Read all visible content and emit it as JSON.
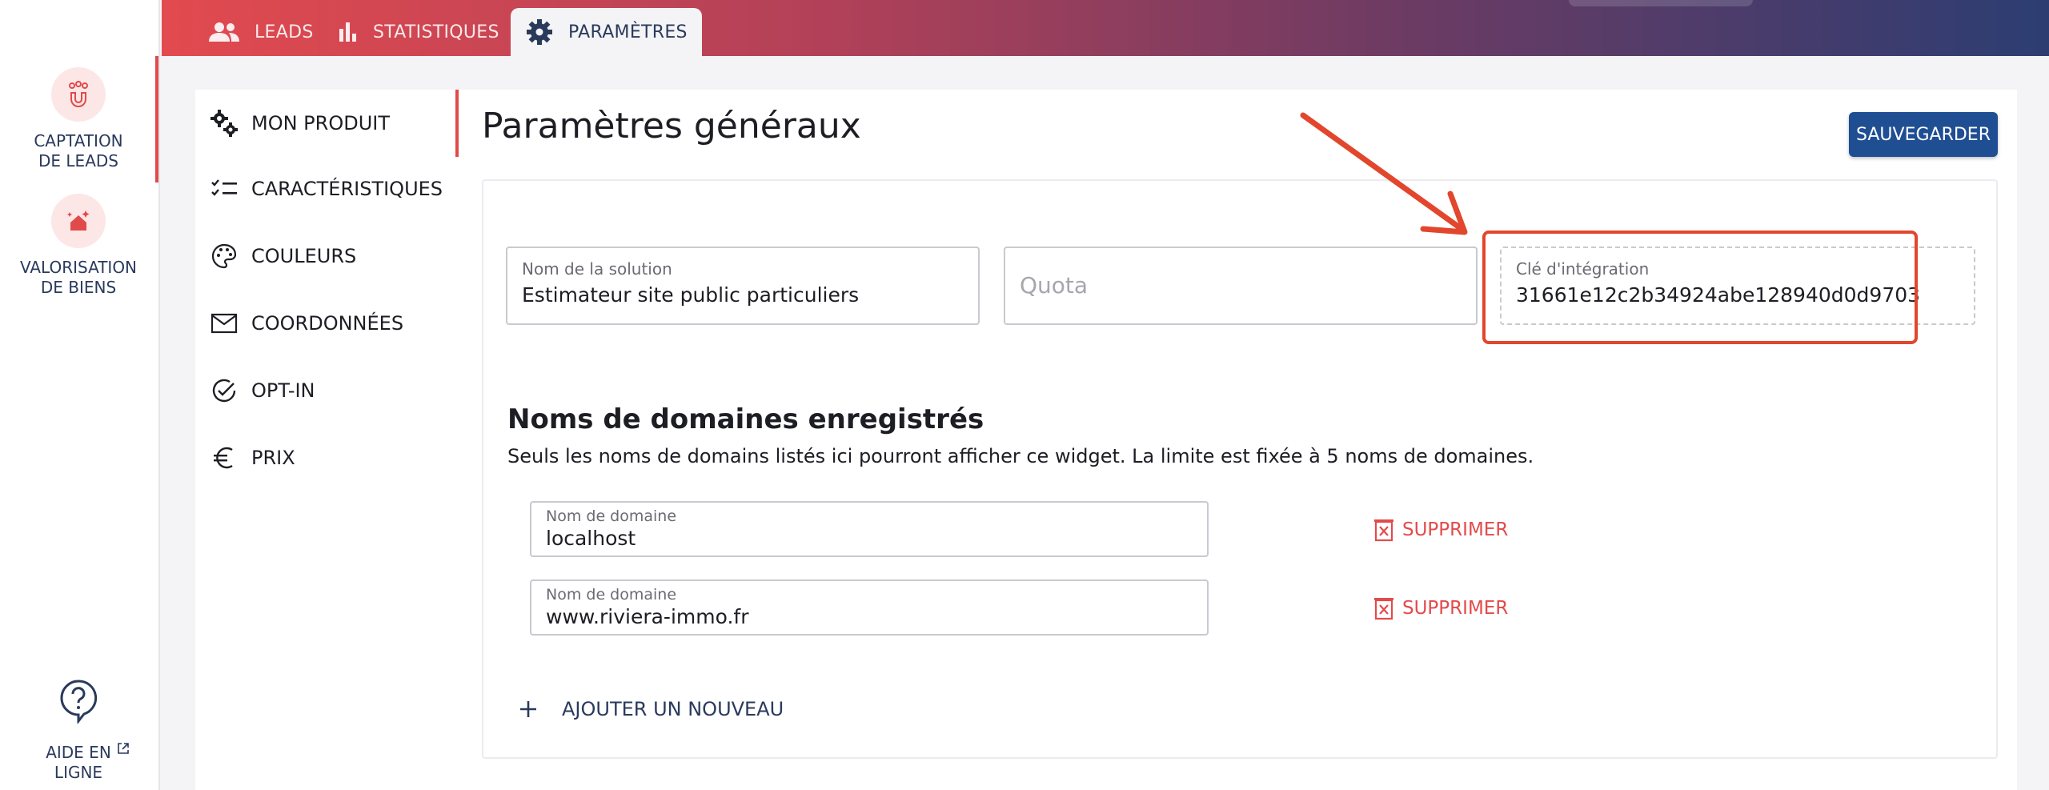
{
  "rail": {
    "items": [
      {
        "label_line1": "CAPTATION",
        "label_line2": "DE LEADS",
        "icon": "magnet-users-icon"
      },
      {
        "label_line1": "VALORISATION",
        "label_line2": "DE BIENS",
        "icon": "house-sparkle-icon"
      }
    ],
    "help": {
      "label_line1": "AIDE EN",
      "label_line2": "LIGNE",
      "icon": "help-bubble-icon"
    }
  },
  "topbar": {
    "tabs": [
      {
        "label": "LEADS",
        "icon": "users-icon"
      },
      {
        "label": "STATISTIQUES",
        "icon": "bar-chart-icon"
      },
      {
        "label": "PARAMÈTRES",
        "icon": "gear-icon",
        "active": true
      }
    ]
  },
  "subnav": {
    "items": [
      {
        "label": "MON PRODUIT",
        "icon": "gears-icon",
        "active": true
      },
      {
        "label": "CARACTÉRISTIQUES",
        "icon": "checklist-icon"
      },
      {
        "label": "COULEURS",
        "icon": "palette-icon"
      },
      {
        "label": "COORDONNÉES",
        "icon": "envelope-icon"
      },
      {
        "label": "OPT-IN",
        "icon": "check-circle-icon"
      },
      {
        "label": "PRIX",
        "icon": "euro-icon"
      }
    ]
  },
  "main": {
    "title": "Paramètres généraux",
    "save_label": "SAUVEGARDER",
    "fields": {
      "solution_name": {
        "label": "Nom de la solution",
        "value": "Estimateur site public particuliers"
      },
      "quota": {
        "placeholder": "Quota"
      },
      "integration_key": {
        "label": "Clé d'intégration",
        "value": "31661e12c2b34924abe128940d0d9703"
      }
    },
    "domains": {
      "title": "Noms de domaines enregistrés",
      "subtitle": "Seuls les noms de domains listés ici pourront afficher ce widget. La limite est fixée à 5 noms de domaines.",
      "items": [
        {
          "label": "Nom de domaine",
          "value": "localhost",
          "delete_label": "SUPPRIMER"
        },
        {
          "label": "Nom de domaine",
          "value": "www.riviera-immo.fr",
          "delete_label": "SUPPRIMER"
        }
      ],
      "add_label": "AJOUTER UN NOUVEAU"
    }
  },
  "colors": {
    "accent_red": "#e14a4a",
    "annotation_orange": "#e2462c",
    "primary_blue": "#1f4e93",
    "nav_text": "#2a3a5c"
  }
}
